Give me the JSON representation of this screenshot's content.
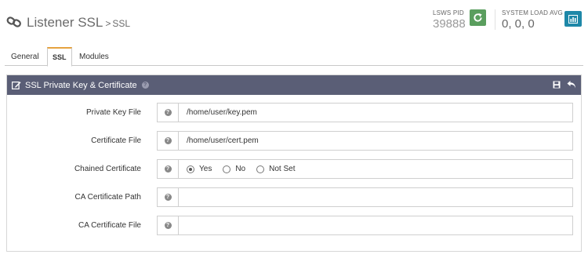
{
  "header": {
    "title": "Listener SSL",
    "crumb_sep": ">",
    "crumb": "SSL",
    "pid_label": "LSWS PID",
    "pid_value": "39888",
    "load_label": "SYSTEM LOAD AVG",
    "load_value": "0, 0, 0",
    "icons": {
      "title": "link-icon",
      "restart": "refresh-icon",
      "stats": "bar-chart-icon"
    },
    "colors": {
      "restart": "#5a9e5e",
      "stats": "#1e88a8"
    }
  },
  "tabs": [
    {
      "label": "General",
      "active": false
    },
    {
      "label": "SSL",
      "active": true
    },
    {
      "label": "Modules",
      "active": false
    }
  ],
  "panel": {
    "title": "SSL Private Key & Certificate",
    "header_color": "#5a5e76",
    "icons": {
      "title": "edit-icon",
      "save": "save-icon",
      "back": "undo-icon"
    },
    "rows": [
      {
        "label": "Private Key File",
        "value": "/home/user/key.pem"
      },
      {
        "label": "Certificate File",
        "value": "/home/user/cert.pem"
      },
      {
        "label": "Chained Certificate",
        "options": [
          "Yes",
          "No",
          "Not Set"
        ],
        "selected": "Yes"
      },
      {
        "label": "CA Certificate Path",
        "value": ""
      },
      {
        "label": "CA Certificate File",
        "value": ""
      }
    ]
  }
}
